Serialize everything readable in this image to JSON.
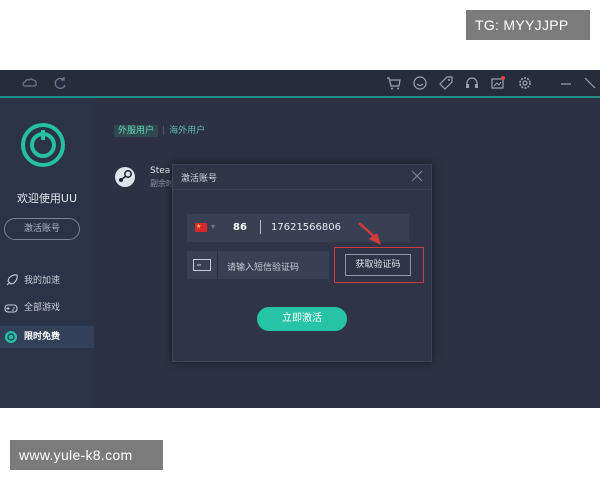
{
  "watermarks": {
    "top": "TG: MYYJJPP",
    "bottom": "www.yule-k8.com"
  },
  "sidebar": {
    "welcome": "欢迎使用UU",
    "activate_account_button": "激活账号",
    "items": [
      {
        "label": "我的加速",
        "icon": "rocket-icon"
      },
      {
        "label": "全部游戏",
        "icon": "gamepad-icon"
      },
      {
        "label": "限时免费",
        "icon": "free-icon",
        "active": true
      }
    ]
  },
  "main": {
    "tabs": [
      {
        "label": "外服用户",
        "active": true
      },
      {
        "label": "海外用户",
        "active": false
      }
    ],
    "game": {
      "name": "Stea",
      "sub": "副余时"
    }
  },
  "modal": {
    "title": "激活账号",
    "country_code": "86",
    "phone": "17621566806",
    "code_placeholder": "请输入短信验证码",
    "get_code_button": "获取验证码",
    "activate_button": "立即激活"
  },
  "colors": {
    "accent": "#26c3a6",
    "highlight": "#d33a3a"
  }
}
